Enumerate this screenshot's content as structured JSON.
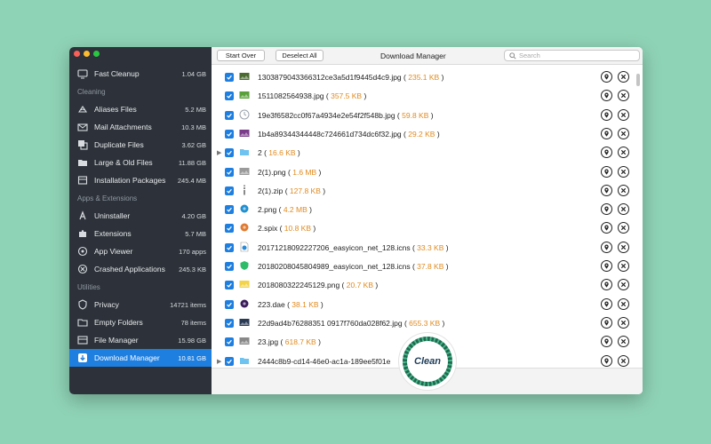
{
  "sidebar": {
    "top": [
      {
        "label": "Fast Cleanup",
        "value": "1.04 GB",
        "icon": "monitor-icon"
      }
    ],
    "sections": [
      {
        "title": "Cleaning",
        "items": [
          {
            "label": "Aliases Files",
            "value": "5.2 MB",
            "icon": "alias-icon"
          },
          {
            "label": "Mail Attachments",
            "value": "10.3 MB",
            "icon": "mail-icon"
          },
          {
            "label": "Duplicate Files",
            "value": "3.62 GB",
            "icon": "duplicate-icon"
          },
          {
            "label": "Large & Old Files",
            "value": "11.88 GB",
            "icon": "folder-icon"
          },
          {
            "label": "Installation Packages",
            "value": "245.4 MB",
            "icon": "package-icon"
          }
        ]
      },
      {
        "title": "Apps & Extensions",
        "items": [
          {
            "label": "Uninstaller",
            "value": "4.20 GB",
            "icon": "app-store-icon"
          },
          {
            "label": "Extensions",
            "value": "5.7 MB",
            "icon": "puzzle-icon"
          },
          {
            "label": "App Viewer",
            "value": "170 apps",
            "icon": "eye-icon"
          },
          {
            "label": "Crashed Applications",
            "value": "245.3 KB",
            "icon": "crash-icon"
          }
        ]
      },
      {
        "title": "Utilities",
        "items": [
          {
            "label": "Privacy",
            "value": "14721 items",
            "icon": "shield-icon"
          },
          {
            "label": "Empty Folders",
            "value": "78 items",
            "icon": "empty-folder-icon"
          },
          {
            "label": "File Manager",
            "value": "15.98 GB",
            "icon": "file-manager-icon"
          },
          {
            "label": "Download Manager",
            "value": "10.81 GB",
            "icon": "download-icon",
            "active": true
          }
        ]
      }
    ]
  },
  "toolbar": {
    "start_over": "Start Over",
    "deselect_all": "Deselect All",
    "title": "Download Manager",
    "search_placeholder": "Search"
  },
  "files": [
    {
      "name": "1303879043366312ce3a5d1f9445d4c9.jpg",
      "size": "235.1 KB",
      "icon": "image-thumb-icon",
      "icon_color": "#4a6a30"
    },
    {
      "name": "1511082564938.jpg",
      "size": "357.5 KB",
      "icon": "image-thumb-icon",
      "icon_color": "#5aa03a"
    },
    {
      "name": "19e3f6582cc0f67a4934e2e54f2f548b.jpg",
      "size": "59.8 KB",
      "icon": "clock-thumb-icon",
      "icon_color": "#9aa3ad"
    },
    {
      "name": "1b4a89344344448c724661d734dc6f32.jpg",
      "size": "29.2 KB",
      "icon": "image-thumb-icon",
      "icon_color": "#7a3b8a"
    },
    {
      "name": "2",
      "size": "16.6 KB",
      "icon": "folder-icon",
      "icon_color": "#6ec3f0",
      "expandable": true
    },
    {
      "name": "2(1).png",
      "size": "1.6 MB",
      "icon": "image-thumb-icon",
      "icon_color": "#9a9a9a"
    },
    {
      "name": "2(1).zip",
      "size": "127.8 KB",
      "icon": "zip-icon",
      "icon_color": "#8a8a8a"
    },
    {
      "name": "2.png",
      "size": "4.2 MB",
      "icon": "circle-thumb-icon",
      "icon_color": "#1e8fd0"
    },
    {
      "name": "2.spix",
      "size": "10.8 KB",
      "icon": "circle-thumb-icon",
      "icon_color": "#e07a30"
    },
    {
      "name": "20171218092227206_easyicon_net_128.icns",
      "size": "33.3 KB",
      "icon": "doc-icon",
      "icon_color": "#2a8ad6"
    },
    {
      "name": "20180208045804989_easyicon_net_128.icns",
      "size": "37.8 KB",
      "icon": "shield-thumb-icon",
      "icon_color": "#2dbd6a"
    },
    {
      "name": "2018080322245129.png",
      "size": "20.7 KB",
      "icon": "image-thumb-icon",
      "icon_color": "#f2d34a"
    },
    {
      "name": "223.dae",
      "size": "38.1 KB",
      "icon": "circle-thumb-icon",
      "icon_color": "#3a1a5a"
    },
    {
      "name": "22d9ad4b76288351 0917f760da028f62.jpg",
      "size": "655.3 KB",
      "icon": "image-thumb-icon",
      "icon_color": "#2a3a55"
    },
    {
      "name": "23.jpg",
      "size": "618.7 KB",
      "icon": "image-thumb-icon",
      "icon_color": "#888888"
    },
    {
      "name": "2444c8b9-cd14-46e0-ac1a-189ee5f01e",
      "size": "",
      "icon": "folder-icon",
      "icon_color": "#6ec3f0",
      "expandable": true
    }
  ],
  "clean_label": "Clean"
}
